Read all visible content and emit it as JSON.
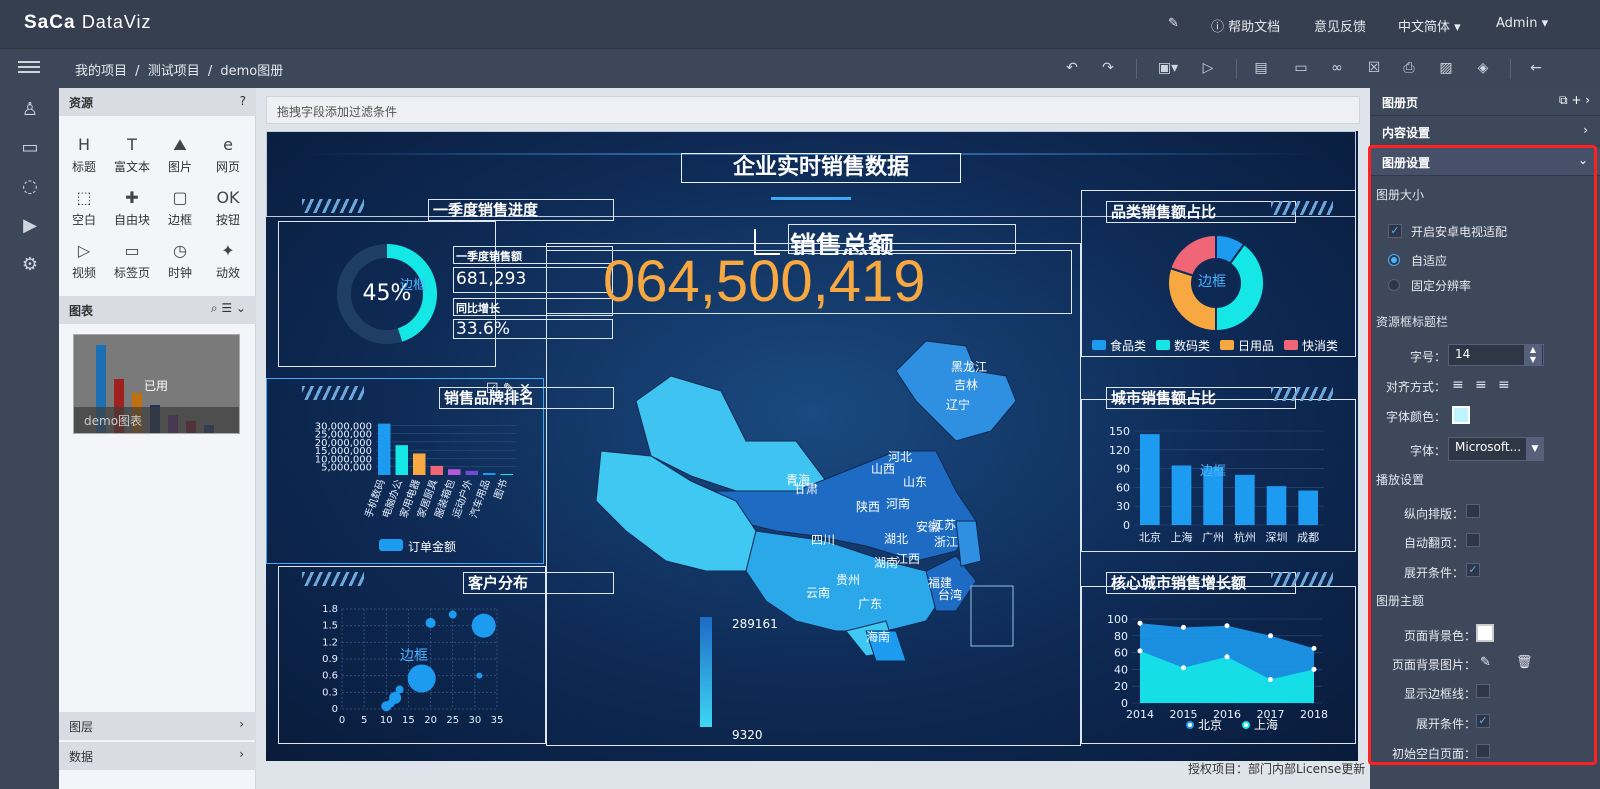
{
  "topbar": {
    "logo_brand": "SaCa",
    "logo_product": "DataViz",
    "help": "帮助文档",
    "feedback": "意见反馈",
    "language": "中文简体",
    "user": "Admin"
  },
  "breadcrumb": [
    "我的项目",
    "/",
    "测试项目",
    "/",
    "demo图册"
  ],
  "resources": {
    "title": "资源",
    "items": [
      "标题",
      "富文本",
      "图片",
      "网页",
      "空白",
      "自由块",
      "边框",
      "按钮",
      "视频",
      "标签页",
      "时钟",
      "动效"
    ]
  },
  "charts_panel": {
    "title": "图表",
    "thumb_used": "已用",
    "thumb_name": "demo图表"
  },
  "bottom_panels": [
    "图层",
    "数据"
  ],
  "filterbar": {
    "placeholder": "拖拽字段添加过滤条件"
  },
  "dashboard": {
    "title": "企业实时销售数据",
    "q1_title": "一季度销售进度",
    "q1_percent": "45%",
    "q1_frame": "边框",
    "q1_sales_label": "一季度销售额",
    "q1_sales_value": "681,293",
    "q1_growth_label": "同比增长",
    "q1_growth_value": "33.6%",
    "total_title": "销售总额",
    "total_value": "064,500,419",
    "brand_title": "销售品牌排名",
    "customer_title": "客户分布",
    "customer_frame": "边框",
    "category_title": "品类销售额占比",
    "category_frame": "边框",
    "city_title": "城市销售额占比",
    "city_frame": "边框",
    "growth_title": "核心城市销售增长额",
    "map_max": "289161",
    "map_min": "9320",
    "provinces": [
      "黑龙江",
      "吉林",
      "辽宁",
      "青海",
      "甘肃",
      "山西",
      "河北",
      "山东",
      "陕西",
      "河南",
      "安徽",
      "江苏",
      "四川",
      "湖北",
      "浙江",
      "江西",
      "湖南",
      "贵州",
      "福建",
      "云南",
      "广东",
      "台湾",
      "海南"
    ]
  },
  "chart_data": [
    {
      "type": "bar",
      "title": "销售品牌排名",
      "categories": [
        "手机数码",
        "电脑办公",
        "家用电器",
        "家居厨具",
        "服装箱包",
        "运动户外",
        "汽车用品",
        "图书"
      ],
      "values": [
        31000000,
        18000000,
        13000000,
        5500000,
        3500000,
        2500000,
        1200000,
        600000
      ],
      "colors": [
        "#1c9bf0",
        "#15e7e7",
        "#f7a840",
        "#f06677",
        "#b45ad8",
        "#6f4bd8",
        "#1c9bf0",
        "#15e7e7"
      ],
      "yticks": [
        "30,000,000",
        "25,000,000",
        "20,000,000",
        "15,000,000",
        "10,000,000",
        "5,000,000"
      ],
      "ylim": [
        0,
        35000000
      ],
      "legend": "订单金额"
    },
    {
      "type": "scatter",
      "title": "客户分布",
      "xticks": [
        "0",
        "5",
        "10",
        "15",
        "20",
        "25",
        "30",
        "35"
      ],
      "yticks": [
        "0",
        "0.3",
        "0.6",
        "0.9",
        "1.2",
        "1.5",
        "1.8"
      ],
      "xlim": [
        0,
        35
      ],
      "ylim": [
        0,
        1.8
      ],
      "points": [
        [
          10,
          0.05,
          5
        ],
        [
          11,
          0.1,
          4
        ],
        [
          12,
          0.2,
          6
        ],
        [
          13,
          0.35,
          4
        ],
        [
          18,
          0.55,
          14
        ],
        [
          20,
          1.55,
          5
        ],
        [
          25,
          1.7,
          4
        ],
        [
          31,
          0.6,
          3
        ],
        [
          32,
          1.5,
          12
        ]
      ]
    },
    {
      "type": "pie",
      "title": "品类销售额占比",
      "legend": [
        "食品类",
        "数码类",
        "日用品",
        "快消类"
      ],
      "values": [
        10,
        40,
        30,
        20
      ],
      "colors": [
        "#1c9bf0",
        "#15e7e7",
        "#f7a840",
        "#f06677"
      ]
    },
    {
      "type": "bar",
      "title": "城市销售额占比",
      "categories": [
        "北京",
        "上海",
        "广州",
        "杭州",
        "深圳",
        "成都"
      ],
      "values": [
        145,
        95,
        92,
        80,
        62,
        55
      ],
      "yticks": [
        "0",
        "30",
        "60",
        "90",
        "120",
        "150"
      ],
      "ylim": [
        0,
        150
      ],
      "color": "#1c9bf0"
    },
    {
      "type": "area",
      "title": "核心城市销售增长额",
      "x": [
        "2014",
        "2015",
        "2016",
        "2017",
        "2018"
      ],
      "yticks": [
        "0",
        "20",
        "40",
        "60",
        "80",
        "100"
      ],
      "ylim": [
        0,
        100
      ],
      "series": [
        {
          "name": "北京",
          "values": [
            95,
            90,
            92,
            80,
            65
          ],
          "color": "#1c9bf0"
        },
        {
          "name": "上海",
          "values": [
            62,
            42,
            55,
            28,
            40
          ],
          "color": "#15e7e7"
        }
      ]
    }
  ],
  "rightpanel": {
    "section_page": "图册页",
    "section_content": "内容设置",
    "section_book": "图册设置",
    "size_title": "图册大小",
    "android_tv": "开启安卓电视适配",
    "adaptive": "自适应",
    "fixed_res": "固定分辨率",
    "frame_title_section": "资源框标题栏",
    "font_size_label": "字号：",
    "font_size": "14",
    "align_label": "对齐方式：",
    "font_color_label": "字体颜色：",
    "font_label": "字体：",
    "font_value": "Microsoft...",
    "play_section": "播放设置",
    "vertical": "纵向排版：",
    "auto_page": "自动翻页：",
    "expand_cond": "展开条件：",
    "theme_section": "图册主题",
    "bg_color": "页面背景色：",
    "bg_image": "页面背景图片：",
    "show_border": "显示边框线：",
    "expand_cond2": "展开条件：",
    "init_blank": "初始空白页面："
  },
  "license": "授权项目：部门内部License更新"
}
